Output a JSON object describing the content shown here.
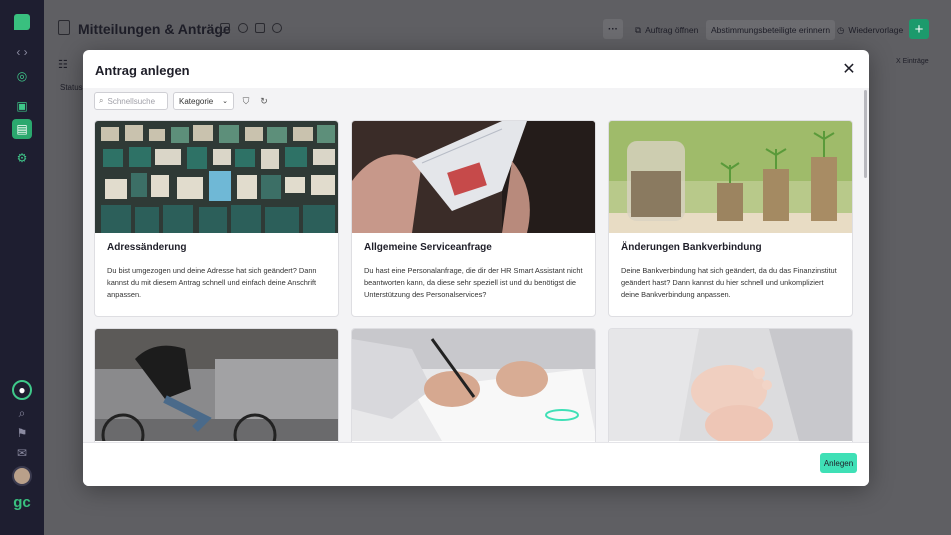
{
  "page": {
    "title": "Mitteilungen & Anträge",
    "toolbar": {
      "open_request": "Auftrag öffnen",
      "remind": "Abstimmungsbeteiligte erinnern",
      "resubmit": "Wiedervorlage",
      "add": "+"
    },
    "status_label": "Status",
    "entries_label": "X Einträge"
  },
  "modal": {
    "title": "Antrag anlegen",
    "close": "✕",
    "search": {
      "placeholder": "Schnellsuche"
    },
    "category": {
      "label": "Kategorie"
    },
    "create_button": "Anlegen",
    "cards": [
      {
        "title": "Adressänderung",
        "description": "Du bist umgezogen und deine Adresse hat sich geändert? Dann kannst du mit diesem Antrag schnell und einfach deine Anschrift anpassen."
      },
      {
        "title": "Allgemeine Serviceanfrage",
        "description": "Du hast eine Personalanfrage, die dir der HR Smart Assistant nicht beantworten kann, da diese sehr speziell ist und du benötigst die Unterstützung des Personalservices?"
      },
      {
        "title": "Änderungen Bankverbindung",
        "description": "Deine Bankverbindung hat sich geändert, da du das Finanzinstitut geändert hast? Dann kannst du hier schnell und unkompliziert deine Bankverbindung anpassen."
      },
      {
        "title": "",
        "description": ""
      },
      {
        "title": "",
        "description": ""
      },
      {
        "title": "",
        "description": ""
      }
    ]
  },
  "brand": {
    "short": "gc",
    "accent": "#3fe0b6",
    "primary": "#2aa86e"
  }
}
